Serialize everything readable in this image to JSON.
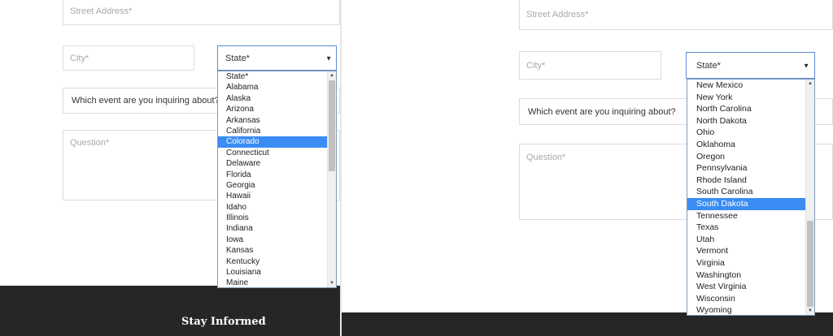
{
  "left_panel": {
    "street_placeholder": "Street Address*",
    "city_placeholder": "City*",
    "state_selected": "State*",
    "event_placeholder": "Which event are you inquiring about?",
    "question_placeholder": "Question*",
    "dropdown": {
      "options": [
        "State*",
        "Alabama",
        "Alaska",
        "Arizona",
        "Arkansas",
        "California",
        "Colorado",
        "Connecticut",
        "Delaware",
        "Florida",
        "Georgia",
        "Hawaii",
        "Idaho",
        "Illinois",
        "Indiana",
        "Iowa",
        "Kansas",
        "Kentucky",
        "Louisiana",
        "Maine"
      ],
      "highlighted": "Colorado",
      "scroll_position": 0.0
    },
    "footer_title": "Stay Informed"
  },
  "right_panel": {
    "street_placeholder": "Street Address*",
    "city_placeholder": "City*",
    "state_selected": "State*",
    "event_placeholder": "Which event are you inquiring about?",
    "question_placeholder": "Question*",
    "dropdown": {
      "options": [
        "New Mexico",
        "New York",
        "North Carolina",
        "North Dakota",
        "Ohio",
        "Oklahoma",
        "Oregon",
        "Pennsylvania",
        "Rhode Island",
        "South Carolina",
        "South Dakota",
        "Tennessee",
        "Texas",
        "Utah",
        "Vermont",
        "Virginia",
        "Washington",
        "West Virginia",
        "Wisconsin",
        "Wyoming"
      ],
      "highlighted": "South Dakota",
      "scroll_position": 1.0
    }
  },
  "colors": {
    "highlight": "#3b8cf3",
    "select_border": "#5b8cd6",
    "footer_bg": "#262626"
  }
}
